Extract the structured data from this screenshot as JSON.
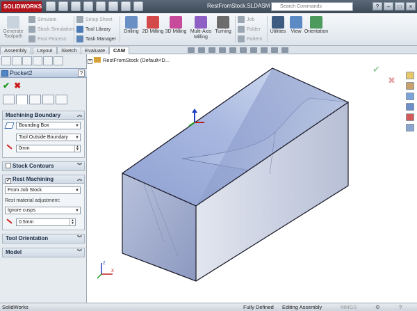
{
  "app": {
    "logo_text": "SOLIDWORKS",
    "document_title": "RestFromStock.SLDASM *",
    "search_placeholder": "Search Commands"
  },
  "ribbon": {
    "generate_toolpath": "Generate Toolpath",
    "simulate": "Simulate",
    "stock_simulation": "Stock Simulation",
    "post_process": "Post Process",
    "setup_sheet": "Setup Sheet",
    "tool_library": "Tool Library",
    "task_manager": "Task Manager",
    "drilling": "Drilling",
    "milling_2d": "2D Milling",
    "milling_3d": "3D Milling",
    "multi_axis_milling": "Multi-Axis Milling",
    "turning": "Turning",
    "job": "Job",
    "folder": "Folder",
    "pattern": "Pattern",
    "utilities": "Utilities",
    "view": "View",
    "orientation": "Orientation"
  },
  "tabs": [
    "Assembly",
    "Layout",
    "Sketch",
    "Evaluate",
    "CAM"
  ],
  "active_tab": "CAM",
  "property_manager": {
    "title": "Pocket2",
    "help": "?",
    "machining_boundary": {
      "header": "Machining Boundary",
      "boundary_type": "Bounding Box",
      "boundary_position": "Tool Outside Boundary",
      "offset": "0mm"
    },
    "stock_contours": {
      "header": "Stock Contours"
    },
    "rest_machining": {
      "header": "Rest Machining",
      "source": "From Job Stock",
      "adjustment_label": "Rest material adjustment:",
      "adjustment": "Ignore cusps",
      "offset": "0.5mm"
    },
    "tool_orientation": {
      "header": "Tool Orientation"
    },
    "model": {
      "header": "Model"
    }
  },
  "viewport": {
    "tree_item": "RestFromStock  (Default<D..."
  },
  "status_bar": {
    "app_name": "SolidWorks",
    "state": "Fully Defined",
    "mode": "Editing Assembly",
    "units": "MMGS"
  },
  "colors": {
    "titlebar": "#46525f",
    "model_face_light": "#c5d2ec",
    "model_face_dark": "#7d8fc0",
    "accent_red": "#b3121b"
  }
}
